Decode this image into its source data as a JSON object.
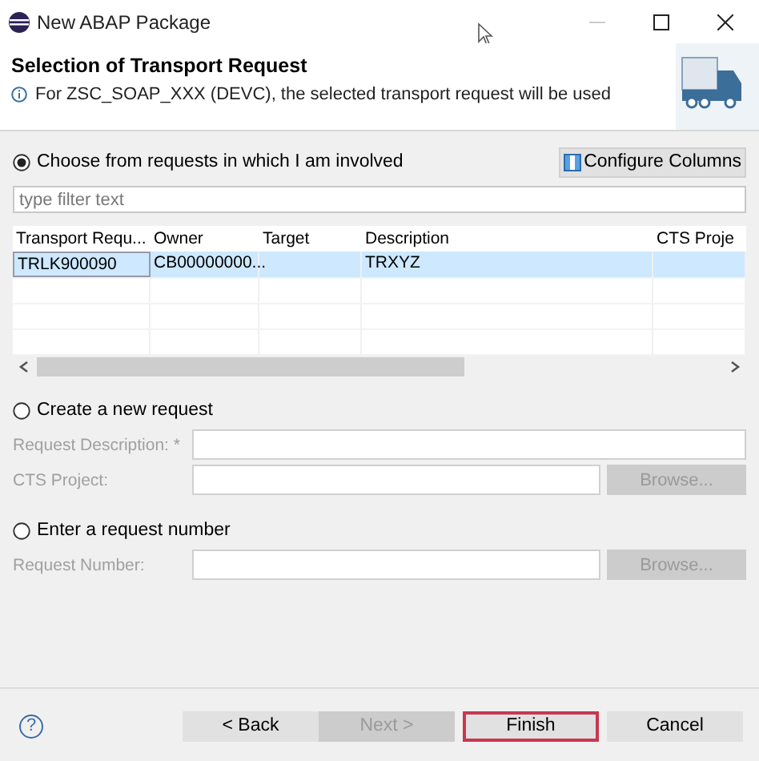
{
  "window": {
    "title": "New ABAP Package"
  },
  "header": {
    "title": "Selection of Transport Request",
    "message": "For ZSC_SOAP_XXX (DEVC), the selected transport request will be used"
  },
  "involved": {
    "label": "Choose from requests in which I am involved",
    "selected": true,
    "configure_button": "Configure Columns",
    "filter": {
      "placeholder": "type filter text"
    },
    "table": {
      "columns": [
        "Transport Requ...",
        "Owner",
        "Target",
        "Description",
        "CTS Proje"
      ],
      "rows": [
        {
          "cells": [
            "TRLK900090",
            "CB00000000...",
            null,
            "TRXYZ",
            null
          ],
          "selected": true
        }
      ]
    }
  },
  "create": {
    "label": "Create a new request",
    "selected": false,
    "fields": [
      {
        "label": "Request Description: *",
        "disabled": true
      },
      {
        "label": "CTS Project:",
        "disabled": true,
        "browse": {
          "label": "Browse...",
          "disabled": true
        }
      }
    ]
  },
  "number": {
    "label": "Enter a request number",
    "selected": false,
    "fields": [
      {
        "label": "Request Number:",
        "disabled": true,
        "browse": {
          "label": "Browse...",
          "disabled": true
        }
      }
    ]
  },
  "help": "?",
  "buttons": [
    {
      "label": "< Back",
      "disabled": false,
      "default": false
    },
    {
      "label": "Next >",
      "disabled": true,
      "default": false
    },
    {
      "label": "Finish",
      "disabled": false,
      "default": true
    },
    {
      "label": "Cancel",
      "disabled": false,
      "default": false
    }
  ]
}
